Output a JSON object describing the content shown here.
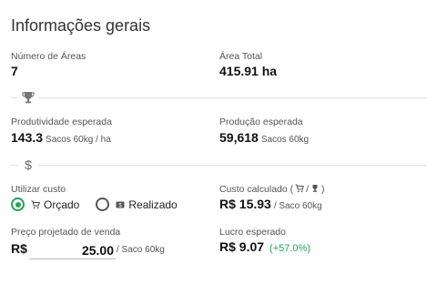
{
  "title": "Informações gerais",
  "areas": {
    "label": "Número de Áreas",
    "value": "7"
  },
  "area_total": {
    "label": "Área Total",
    "value": "415.91 ha"
  },
  "produtividade": {
    "label": "Produtividade esperada",
    "value": "143.3",
    "unit": "Sacos 60kg / ha"
  },
  "producao": {
    "label": "Produção esperada",
    "value": "59,618",
    "unit": "Sacos 60kg"
  },
  "utilizar": {
    "label": "Utilizar custo",
    "options": [
      {
        "label": "Orçado",
        "selected": true,
        "icon": "cart-icon"
      },
      {
        "label": "Realizado",
        "selected": false,
        "icon": "cash-icon"
      }
    ]
  },
  "custo_calculado": {
    "label": "Custo calculado (",
    "label_sep": "/",
    "label_end": ")",
    "value": "R$ 15.93",
    "unit": "/ Saco 60kg"
  },
  "preco": {
    "label": "Preço projetado de venda",
    "currency": "R$",
    "value": "25.00",
    "unit": "/ Saco 60kg"
  },
  "lucro": {
    "label": "Lucro esperado",
    "value": "R$ 9.07",
    "percent": "(+57.0%)"
  },
  "colors": {
    "accent": "#23a455"
  }
}
